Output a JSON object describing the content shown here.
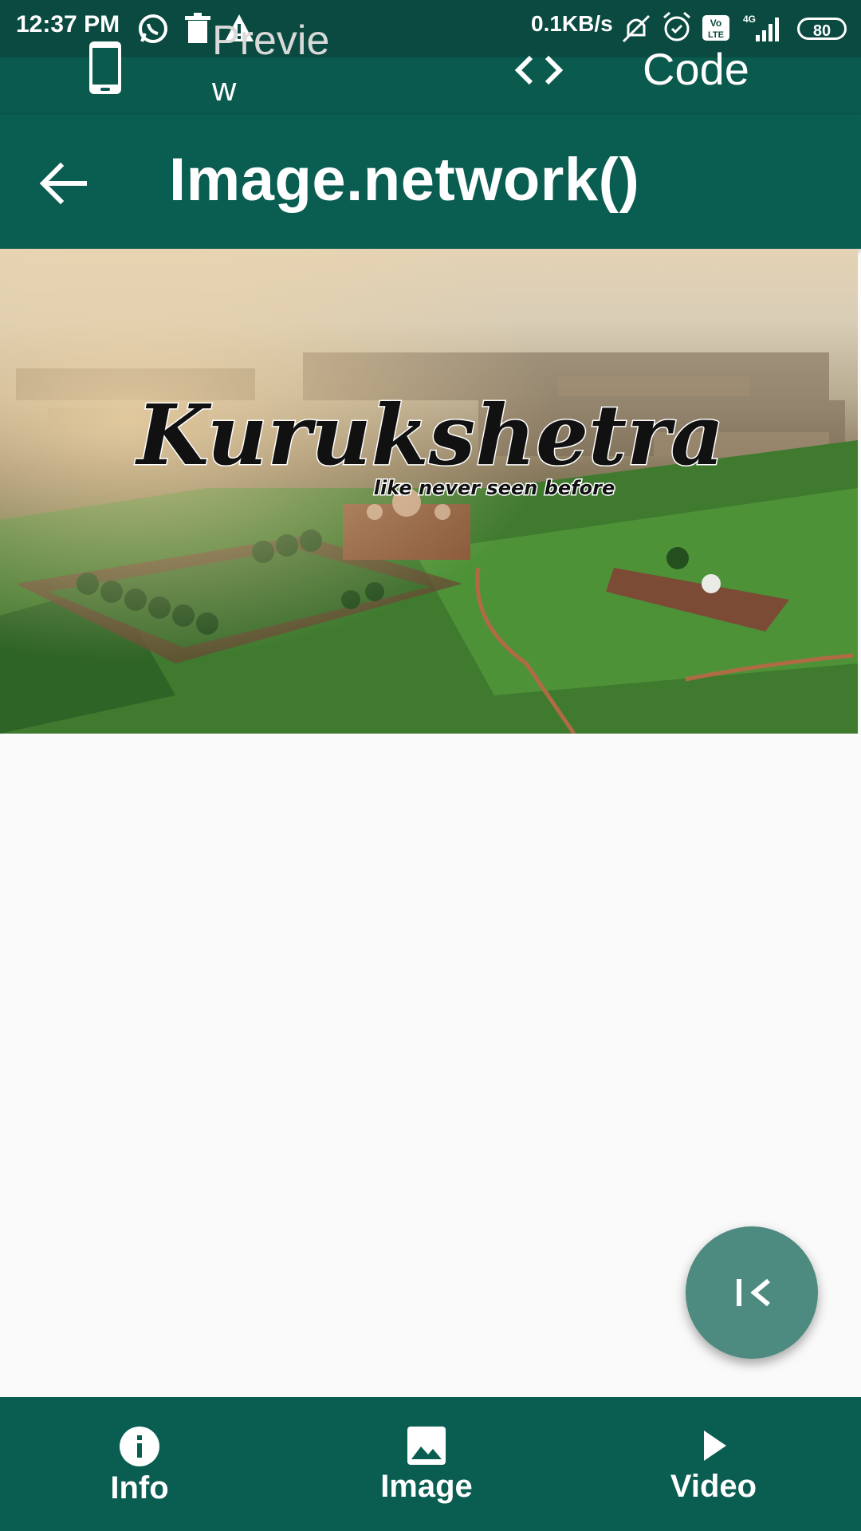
{
  "status_bar": {
    "time": "12:37 PM",
    "net_speed": "0.1KB/s",
    "battery": "80",
    "icons": [
      "whatsapp-icon",
      "trash-icon",
      "warning-icon",
      "mute-icon",
      "alarm-icon",
      "volte-icon",
      "signal-4g-icon",
      "battery-icon"
    ]
  },
  "tabs": {
    "preview_label_line1": "Previe",
    "preview_label_line2": "w",
    "code_label": "Code"
  },
  "appbar": {
    "title": "Image.network()"
  },
  "hero_image": {
    "title": "Kurukshetra",
    "tagline": "like never seen before"
  },
  "bottom_nav": {
    "items": [
      {
        "label": "Info",
        "icon": "info-icon"
      },
      {
        "label": "Image",
        "icon": "image-icon"
      },
      {
        "label": "Video",
        "icon": "play-icon"
      }
    ]
  },
  "colors": {
    "primary": "#0a5d51",
    "primary_dark": "#0a4a40",
    "fab": "#4d8a80",
    "background": "#fafafa"
  }
}
